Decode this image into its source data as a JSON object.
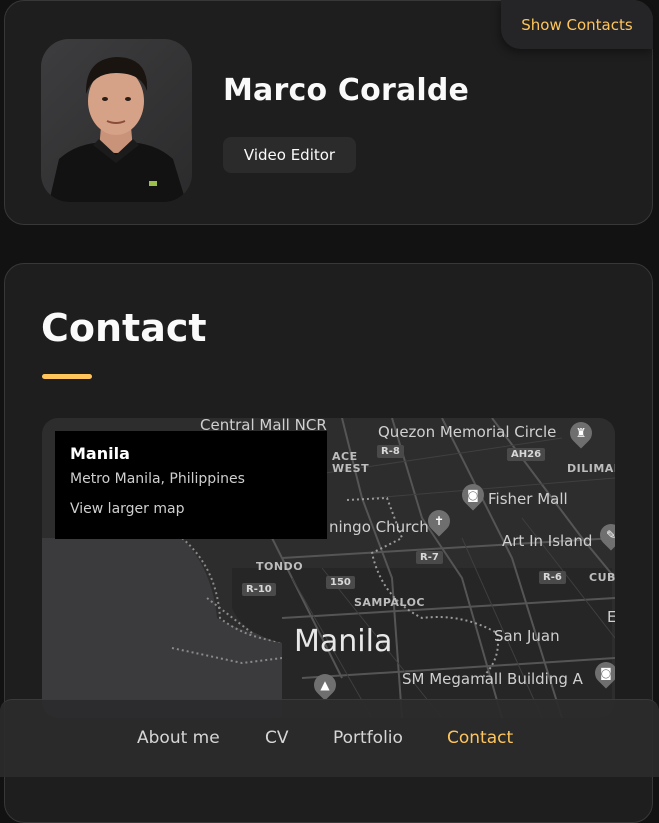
{
  "profile": {
    "name": "Marco Coralde",
    "title": "Video Editor",
    "show_contacts_label": "Show Contacts"
  },
  "contact": {
    "heading": "Contact"
  },
  "map": {
    "info": {
      "place": "Manila",
      "region": "Metro Manila, Philippines",
      "link": "View larger map"
    },
    "labels": {
      "central_mall": "Central Mall NCR",
      "quezon_circle": "Quezon Memorial Circle",
      "ace_west": "ACE",
      "west": "WEST",
      "diliman": "DILIMAN",
      "fisher_mall": "Fisher Mall",
      "church": "ningo Church",
      "art_in_island": "Art In Island",
      "tondo": "TONDO",
      "cub": "CUB",
      "sampaloc": "SAMPALOC",
      "manila": "Manila",
      "san_juan": "San Juan",
      "sm_megamall": "SM Megamall Building A",
      "e_edge": "E"
    },
    "road_badges": {
      "r8": "R-8",
      "ah26": "AH26",
      "r7": "R-7",
      "r6": "R-6",
      "r10": "R-10",
      "n150": "150"
    }
  },
  "nav": {
    "items": [
      "About me",
      "CV",
      "Portfolio",
      "Contact"
    ],
    "active": "Contact"
  },
  "colors": {
    "accent": "#ffc55a",
    "background": "#121212",
    "card": "#1e1e1f"
  }
}
